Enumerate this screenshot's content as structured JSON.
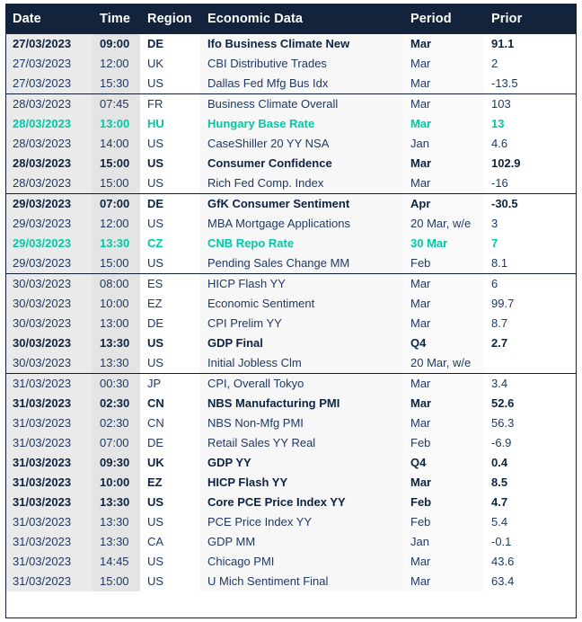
{
  "table": {
    "columns": [
      {
        "key": "date",
        "label": "Date"
      },
      {
        "key": "time",
        "label": "Time"
      },
      {
        "key": "region",
        "label": "Region"
      },
      {
        "key": "data",
        "label": "Economic Data"
      },
      {
        "key": "period",
        "label": "Period"
      },
      {
        "key": "prior",
        "label": "Prior"
      }
    ],
    "rows": [
      {
        "date": "27/03/2023",
        "time": "09:00",
        "region": "DE",
        "data": "Ifo Business Climate New",
        "period": "Mar",
        "prior": "91.1",
        "style": "bold",
        "group_start": true
      },
      {
        "date": "27/03/2023",
        "time": "12:00",
        "region": "UK",
        "data": "CBI Distributive Trades",
        "period": "Mar",
        "prior": "2",
        "style": "normal",
        "group_start": false
      },
      {
        "date": "27/03/2023",
        "time": "15:30",
        "region": "US",
        "data": "Dallas Fed Mfg Bus Idx",
        "period": "Mar",
        "prior": "-13.5",
        "style": "normal",
        "group_start": false
      },
      {
        "date": "28/03/2023",
        "time": "07:45",
        "region": "FR",
        "data": "Business Climate Overall",
        "period": "Mar",
        "prior": "103",
        "style": "normal",
        "group_start": true
      },
      {
        "date": "28/03/2023",
        "time": "13:00",
        "region": "HU",
        "data": "Hungary Base Rate",
        "period": "Mar",
        "prior": "13",
        "style": "teal",
        "group_start": false
      },
      {
        "date": "28/03/2023",
        "time": "14:00",
        "region": "US",
        "data": "CaseShiller 20 YY NSA",
        "period": "Jan",
        "prior": "4.6",
        "style": "normal",
        "group_start": false
      },
      {
        "date": "28/03/2023",
        "time": "15:00",
        "region": "US",
        "data": "Consumer Confidence",
        "period": "Mar",
        "prior": "102.9",
        "style": "bold",
        "group_start": false
      },
      {
        "date": "28/03/2023",
        "time": "15:00",
        "region": "US",
        "data": "Rich Fed Comp. Index",
        "period": "Mar",
        "prior": "-16",
        "style": "normal",
        "group_start": false
      },
      {
        "date": "29/03/2023",
        "time": "07:00",
        "region": "DE",
        "data": "GfK Consumer Sentiment",
        "period": "Apr",
        "prior": "-30.5",
        "style": "bold",
        "group_start": true
      },
      {
        "date": "29/03/2023",
        "time": "12:00",
        "region": "US",
        "data": "MBA Mortgage Applications",
        "period": "20 Mar, w/e",
        "prior": "3",
        "style": "normal",
        "group_start": false
      },
      {
        "date": "29/03/2023",
        "time": "13:30",
        "region": "CZ",
        "data": "CNB Repo Rate",
        "period": "30 Mar",
        "prior": "7",
        "style": "teal",
        "group_start": false
      },
      {
        "date": "29/03/2023",
        "time": "15:00",
        "region": "US",
        "data": "Pending Sales Change MM",
        "period": "Feb",
        "prior": "8.1",
        "style": "normal",
        "group_start": false
      },
      {
        "date": "30/03/2023",
        "time": "08:00",
        "region": "ES",
        "data": "HICP Flash YY",
        "period": "Mar",
        "prior": "6",
        "style": "normal",
        "group_start": true
      },
      {
        "date": "30/03/2023",
        "time": "10:00",
        "region": "EZ",
        "data": "Economic Sentiment",
        "period": "Mar",
        "prior": "99.7",
        "style": "normal",
        "group_start": false
      },
      {
        "date": "30/03/2023",
        "time": "13:00",
        "region": "DE",
        "data": "CPI Prelim YY",
        "period": "Mar",
        "prior": "8.7",
        "style": "normal",
        "group_start": false
      },
      {
        "date": "30/03/2023",
        "time": "13:30",
        "region": "US",
        "data": "GDP Final",
        "period": "Q4",
        "prior": "2.7",
        "style": "bold",
        "group_start": false
      },
      {
        "date": "30/03/2023",
        "time": "13:30",
        "region": "US",
        "data": "Initial Jobless Clm",
        "period": "20 Mar, w/e",
        "prior": "",
        "style": "normal",
        "group_start": false
      },
      {
        "date": "31/03/2023",
        "time": "00:30",
        "region": "JP",
        "data": "CPI, Overall Tokyo",
        "period": "Mar",
        "prior": "3.4",
        "style": "normal",
        "group_start": true
      },
      {
        "date": "31/03/2023",
        "time": "02:30",
        "region": "CN",
        "data": "NBS Manufacturing PMI",
        "period": "Mar",
        "prior": "52.6",
        "style": "bold",
        "group_start": false
      },
      {
        "date": "31/03/2023",
        "time": "02:30",
        "region": "CN",
        "data": "NBS Non-Mfg PMI",
        "period": "Mar",
        "prior": "56.3",
        "style": "normal",
        "group_start": false
      },
      {
        "date": "31/03/2023",
        "time": "07:00",
        "region": "DE",
        "data": "Retail Sales YY Real",
        "period": "Feb",
        "prior": "-6.9",
        "style": "normal",
        "group_start": false
      },
      {
        "date": "31/03/2023",
        "time": "09:30",
        "region": "UK",
        "data": "GDP YY",
        "period": "Q4",
        "prior": "0.4",
        "style": "bold",
        "group_start": false
      },
      {
        "date": "31/03/2023",
        "time": "10:00",
        "region": "EZ",
        "data": "HICP Flash YY",
        "period": "Mar",
        "prior": "8.5",
        "style": "bold",
        "group_start": false
      },
      {
        "date": "31/03/2023",
        "time": "13:30",
        "region": "US",
        "data": "Core PCE Price Index YY",
        "period": "Feb",
        "prior": "4.7",
        "style": "bold",
        "group_start": false
      },
      {
        "date": "31/03/2023",
        "time": "13:30",
        "region": "US",
        "data": "PCE Price Index YY",
        "period": "Feb",
        "prior": "5.4",
        "style": "normal",
        "group_start": false
      },
      {
        "date": "31/03/2023",
        "time": "13:30",
        "region": "CA",
        "data": "GDP MM",
        "period": "Jan",
        "prior": "-0.1",
        "style": "normal",
        "group_start": false
      },
      {
        "date": "31/03/2023",
        "time": "14:45",
        "region": "US",
        "data": "Chicago PMI",
        "period": "Mar",
        "prior": "43.6",
        "style": "normal",
        "group_start": false
      },
      {
        "date": "31/03/2023",
        "time": "15:00",
        "region": "US",
        "data": "U Mich Sentiment Final",
        "period": "Mar",
        "prior": "63.4",
        "style": "normal",
        "group_start": false
      }
    ]
  },
  "colors": {
    "header_background": "#13233B",
    "header_text": "#FFFFFF",
    "body_text": "#1F3864",
    "bold_text": "#0E2340",
    "highlight_teal": "#00C9A7",
    "grid_line": "#0E1E33",
    "stripe_date": "#EAEAEA",
    "stripe_time": "#E4E4E4",
    "stripe_region": "#FFFFFF",
    "stripe_data": "#F7F7F7",
    "stripe_period": "#FAFAFA",
    "stripe_prior": "#FFFFFF"
  }
}
